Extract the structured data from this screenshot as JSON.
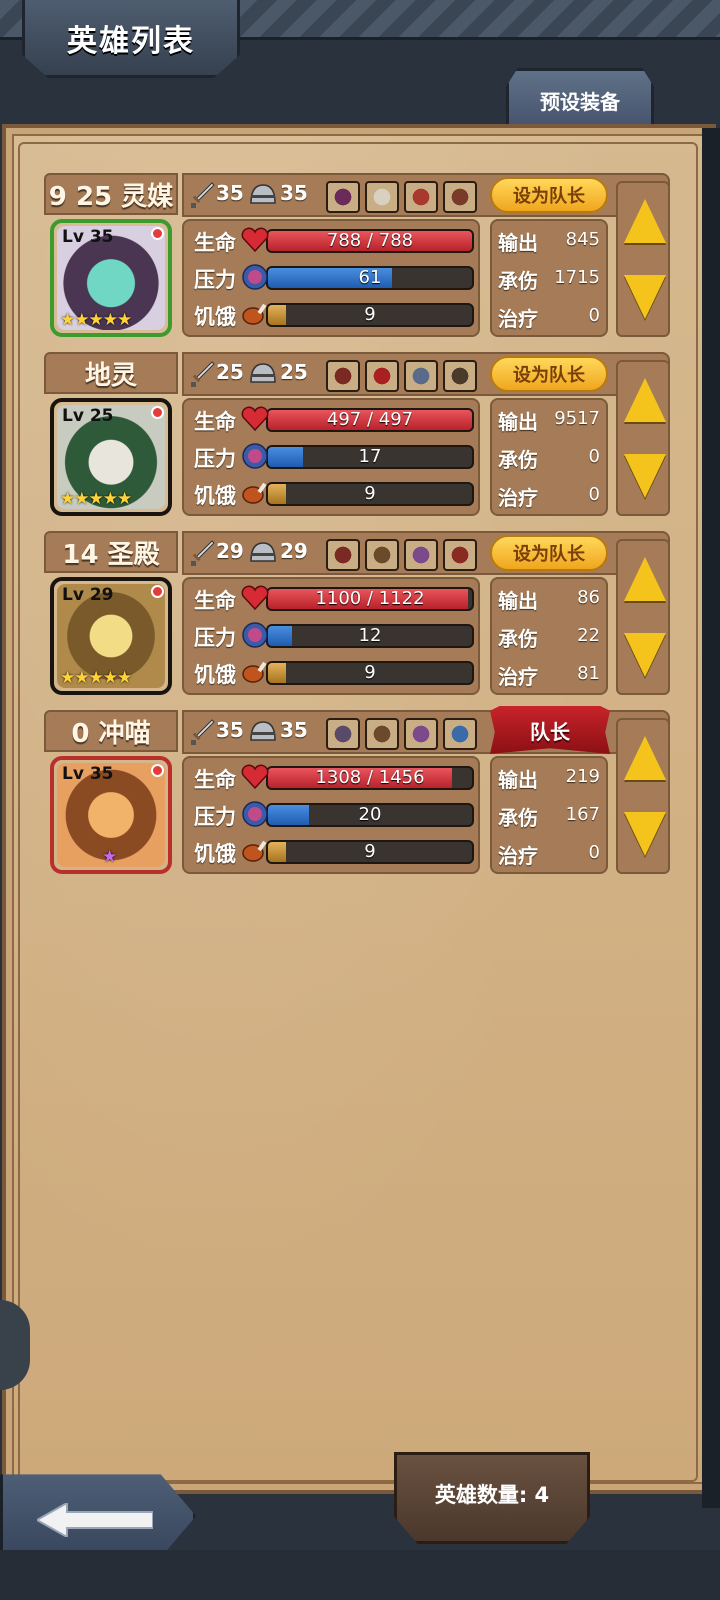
{
  "header": {
    "title": "英雄列表",
    "preset_tab": "预设装备"
  },
  "labels": {
    "hp": "生命",
    "stress": "压力",
    "hunger": "饥饿",
    "damage": "输出",
    "tank": "承伤",
    "heal": "治疗"
  },
  "heroes": [
    {
      "name": "9 25 灵媒",
      "level": "Lv 35",
      "stars": "★★★★★",
      "frame_color": "#3d9a2e",
      "attack": "35",
      "defense": "35",
      "leader_label": "设为队长",
      "is_leader": false,
      "hp": "788 / 788",
      "hp_ratio": 1.0,
      "stress": "61",
      "stress_ratio": 0.61,
      "hunger": "9",
      "hunger_ratio": 0.09,
      "damage": "845",
      "tank": "1715",
      "heal": "0"
    },
    {
      "name": "地灵",
      "level": "Lv 25",
      "stars": "★★★★★",
      "frame_color": "#1a1410",
      "attack": "25",
      "defense": "25",
      "leader_label": "设为队长",
      "is_leader": false,
      "hp": "497 / 497",
      "hp_ratio": 1.0,
      "stress": "17",
      "stress_ratio": 0.17,
      "hunger": "9",
      "hunger_ratio": 0.09,
      "damage": "9517",
      "tank": "0",
      "heal": "0"
    },
    {
      "name": "14 圣殿",
      "level": "Lv 29",
      "stars": "★★★★★",
      "frame_color": "#1a1410",
      "attack": "29",
      "defense": "29",
      "leader_label": "设为队长",
      "is_leader": false,
      "hp": "1100 / 1122",
      "hp_ratio": 0.98,
      "stress": "12",
      "stress_ratio": 0.12,
      "hunger": "9",
      "hunger_ratio": 0.09,
      "damage": "86",
      "tank": "22",
      "heal": "81"
    },
    {
      "name": "0 冲喵",
      "level": "Lv 35",
      "stars": "★",
      "frame_color": "#b9302a",
      "attack": "35",
      "defense": "35",
      "leader_label": "队长",
      "is_leader": true,
      "hp": "1308 / 1456",
      "hp_ratio": 0.9,
      "stress": "20",
      "stress_ratio": 0.2,
      "hunger": "9",
      "hunger_ratio": 0.09,
      "damage": "219",
      "tank": "167",
      "heal": "0"
    }
  ],
  "footer": {
    "hero_count": "英雄数量: 4"
  },
  "colors": {
    "panel": "#cda97a",
    "hp": "#c8323a",
    "stress": "#2f6ec8",
    "hunger": "#c48a2a",
    "leader_button": "#f5b93a",
    "leader_flag": "#b01820"
  },
  "icons": [
    "sword-icon",
    "helmet-icon",
    "heart-icon",
    "brain-icon",
    "meat-icon",
    "up-arrow-icon",
    "down-arrow-icon",
    "back-arrow-icon"
  ]
}
